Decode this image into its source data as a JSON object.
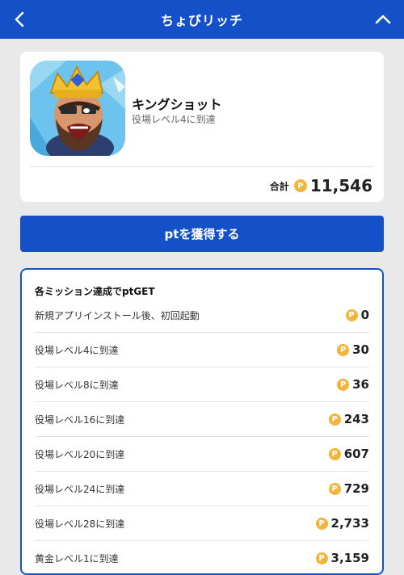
{
  "header": {
    "title": "ちょびリッチ",
    "back_icon": "chevron-left-icon",
    "collapse_icon": "chevron-up-icon"
  },
  "app": {
    "name": "キングショット",
    "condition": "役場レベル4に到達",
    "total_label": "合計",
    "total_value": "11,546",
    "coin_glyph": "P"
  },
  "cta": {
    "label": "ptを獲得する"
  },
  "missions": {
    "title": "各ミッション達成でptGET",
    "items": [
      {
        "name": "新規アプリインストール後、初回起動",
        "points": "0"
      },
      {
        "name": "役場レベル4に到達",
        "points": "30"
      },
      {
        "name": "役場レベル8に到達",
        "points": "36"
      },
      {
        "name": "役場レベル16に到達",
        "points": "243"
      },
      {
        "name": "役場レベル20に到達",
        "points": "607"
      },
      {
        "name": "役場レベル24に到達",
        "points": "729"
      },
      {
        "name": "役場レベル28に到達",
        "points": "2,733"
      },
      {
        "name": "黄金レベル1に到達",
        "points": "3,159"
      }
    ]
  },
  "colors": {
    "brand_blue": "#1450c8",
    "coin_gold": "#f2b53a",
    "background": "#e9e9e9"
  }
}
